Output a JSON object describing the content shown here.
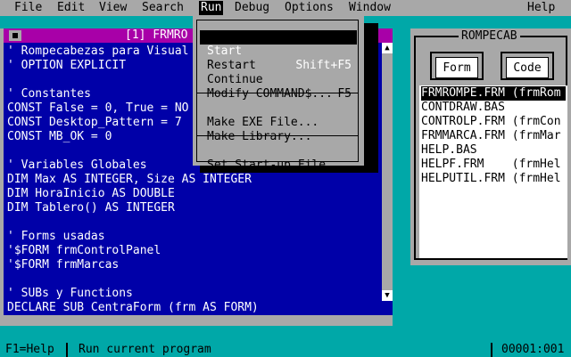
{
  "menubar": {
    "items": [
      "File",
      "Edit",
      "View",
      "Search",
      "Run",
      "Debug",
      "Options",
      "Window",
      "Help"
    ],
    "active": "Run"
  },
  "editor": {
    "title": "[1] FRMRO",
    "lines": [
      "' Rompecabezas para Visual",
      "' OPTION EXPLICIT",
      "",
      "' Constantes",
      "CONST False = 0, True = NO",
      "CONST Desktop_Pattern = 7",
      "CONST MB_OK = 0",
      "",
      "' Variables Globales",
      "DIM Max AS INTEGER, Size AS INTEGER",
      "DIM HoraInicio AS DOUBLE",
      "DIM Tablero() AS INTEGER",
      "",
      "' Forms usadas",
      "'$FORM frmControlPanel",
      "'$FORM frmMarcas",
      "",
      "' SUBs y Functions",
      "DECLARE SUB CentraForm (frm AS FORM)"
    ]
  },
  "run_menu": {
    "items": [
      {
        "label": "Start",
        "shortcut": "Shift+F5"
      },
      {
        "label": "Restart",
        "shortcut": ""
      },
      {
        "label": "Continue",
        "shortcut": "F5"
      },
      {
        "label": "Modify COMMAND$...",
        "shortcut": ""
      },
      {
        "label": "Make EXE File...",
        "shortcut": ""
      },
      {
        "label": "Make Library...",
        "shortcut": ""
      },
      {
        "label": "Set Start-up File...",
        "shortcut": ""
      }
    ]
  },
  "project": {
    "title": "ROMPECAB",
    "form_button": "Form",
    "code_button": "Code",
    "files": [
      "FRMROMPE.FRM (frmRom",
      "CONTDRAW.BAS",
      "CONTROLP.FRM (frmCon",
      "FRMMARCA.FRM (frmMar",
      "HELP.BAS",
      "HELPF.FRM    (frmHel",
      "HELPUTIL.FRM (frmHel"
    ]
  },
  "status": {
    "help": "F1=Help",
    "message": "Run current program",
    "position": "00001:001"
  }
}
